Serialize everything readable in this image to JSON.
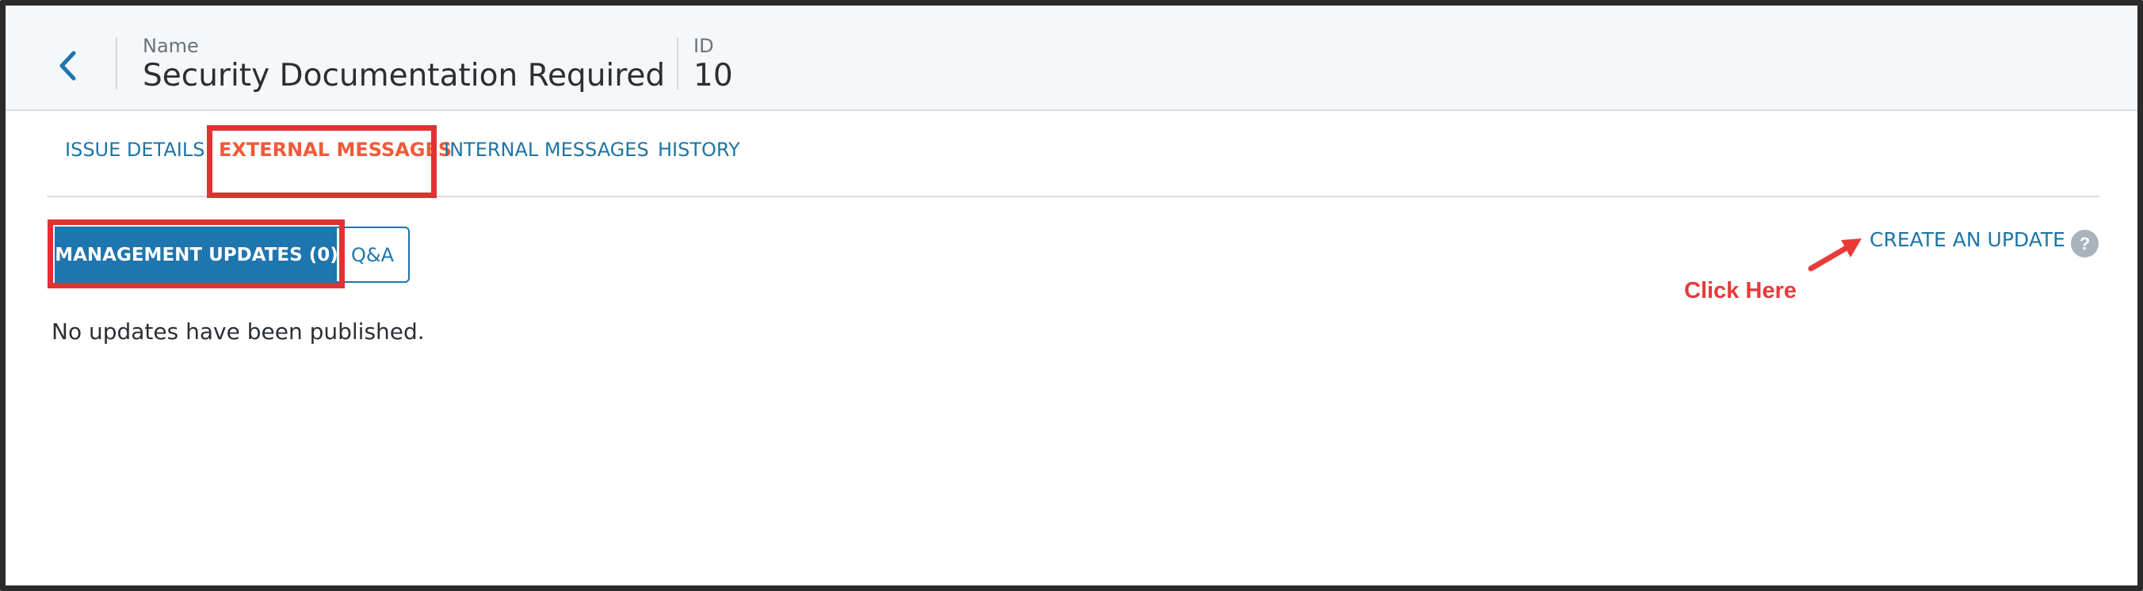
{
  "header": {
    "name_label": "Name",
    "name_value": "Security Documentation Required",
    "id_label": "ID",
    "id_value": "10"
  },
  "tabs": [
    {
      "label": "ISSUE DETAILS",
      "active": false
    },
    {
      "label": "EXTERNAL MESSAGES",
      "active": true
    },
    {
      "label": "INTERNAL MESSAGES",
      "active": false
    },
    {
      "label": "HISTORY",
      "active": false
    }
  ],
  "subtabs": {
    "management_updates": "MANAGEMENT UPDATES (0)",
    "qa": "Q&A"
  },
  "content": {
    "empty_message": "No updates have been published."
  },
  "actions": {
    "create_update": "CREATE AN UPDATE",
    "help_glyph": "?"
  },
  "annotation": {
    "text": "Click Here"
  },
  "colors": {
    "accent": "#1f75ad",
    "active_tab": "#f05a38",
    "highlight": "#e03232",
    "header_bg": "#f5f8fa"
  },
  "icons": [
    "back-chevron-icon",
    "help-icon",
    "annotation-arrow-icon"
  ]
}
